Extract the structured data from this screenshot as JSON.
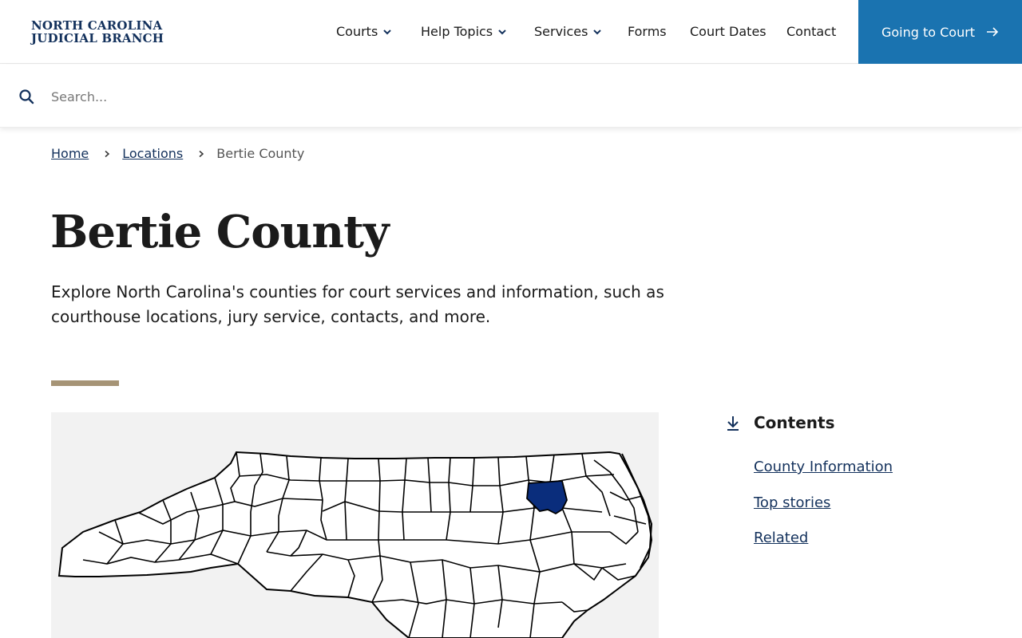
{
  "header": {
    "logo_line1": "NORTH CAROLINA",
    "logo_line2": "JUDICIAL BRANCH",
    "nav": [
      {
        "label": "Courts",
        "has_dropdown": true
      },
      {
        "label": "Help Topics",
        "has_dropdown": true
      },
      {
        "label": "Services",
        "has_dropdown": true
      },
      {
        "label": "Forms",
        "has_dropdown": false
      },
      {
        "label": "Court Dates",
        "has_dropdown": false
      },
      {
        "label": "Contact",
        "has_dropdown": false
      }
    ],
    "cta_label": "Going to Court"
  },
  "search": {
    "placeholder": "Search...",
    "value": ""
  },
  "breadcrumb": {
    "items": [
      "Home",
      "Locations"
    ],
    "current": "Bertie County"
  },
  "page": {
    "title": "Bertie County",
    "intro": "Explore North Carolina's counties for court services and information, such as courthouse locations, jury service, contacts, and more."
  },
  "contents": {
    "heading": "Contents",
    "links": [
      "County Information",
      "Top stories",
      "Related"
    ]
  },
  "colors": {
    "brand_navy": "#13315c",
    "cta_blue": "#1a73b0",
    "accent_tan": "#a69476",
    "highlight_county": "#0a2d7c"
  },
  "icons": {
    "search": "search-icon",
    "chevron": "chevron-down-icon",
    "arrow": "arrow-right-icon",
    "contents": "arrow-down-to-line-icon"
  }
}
